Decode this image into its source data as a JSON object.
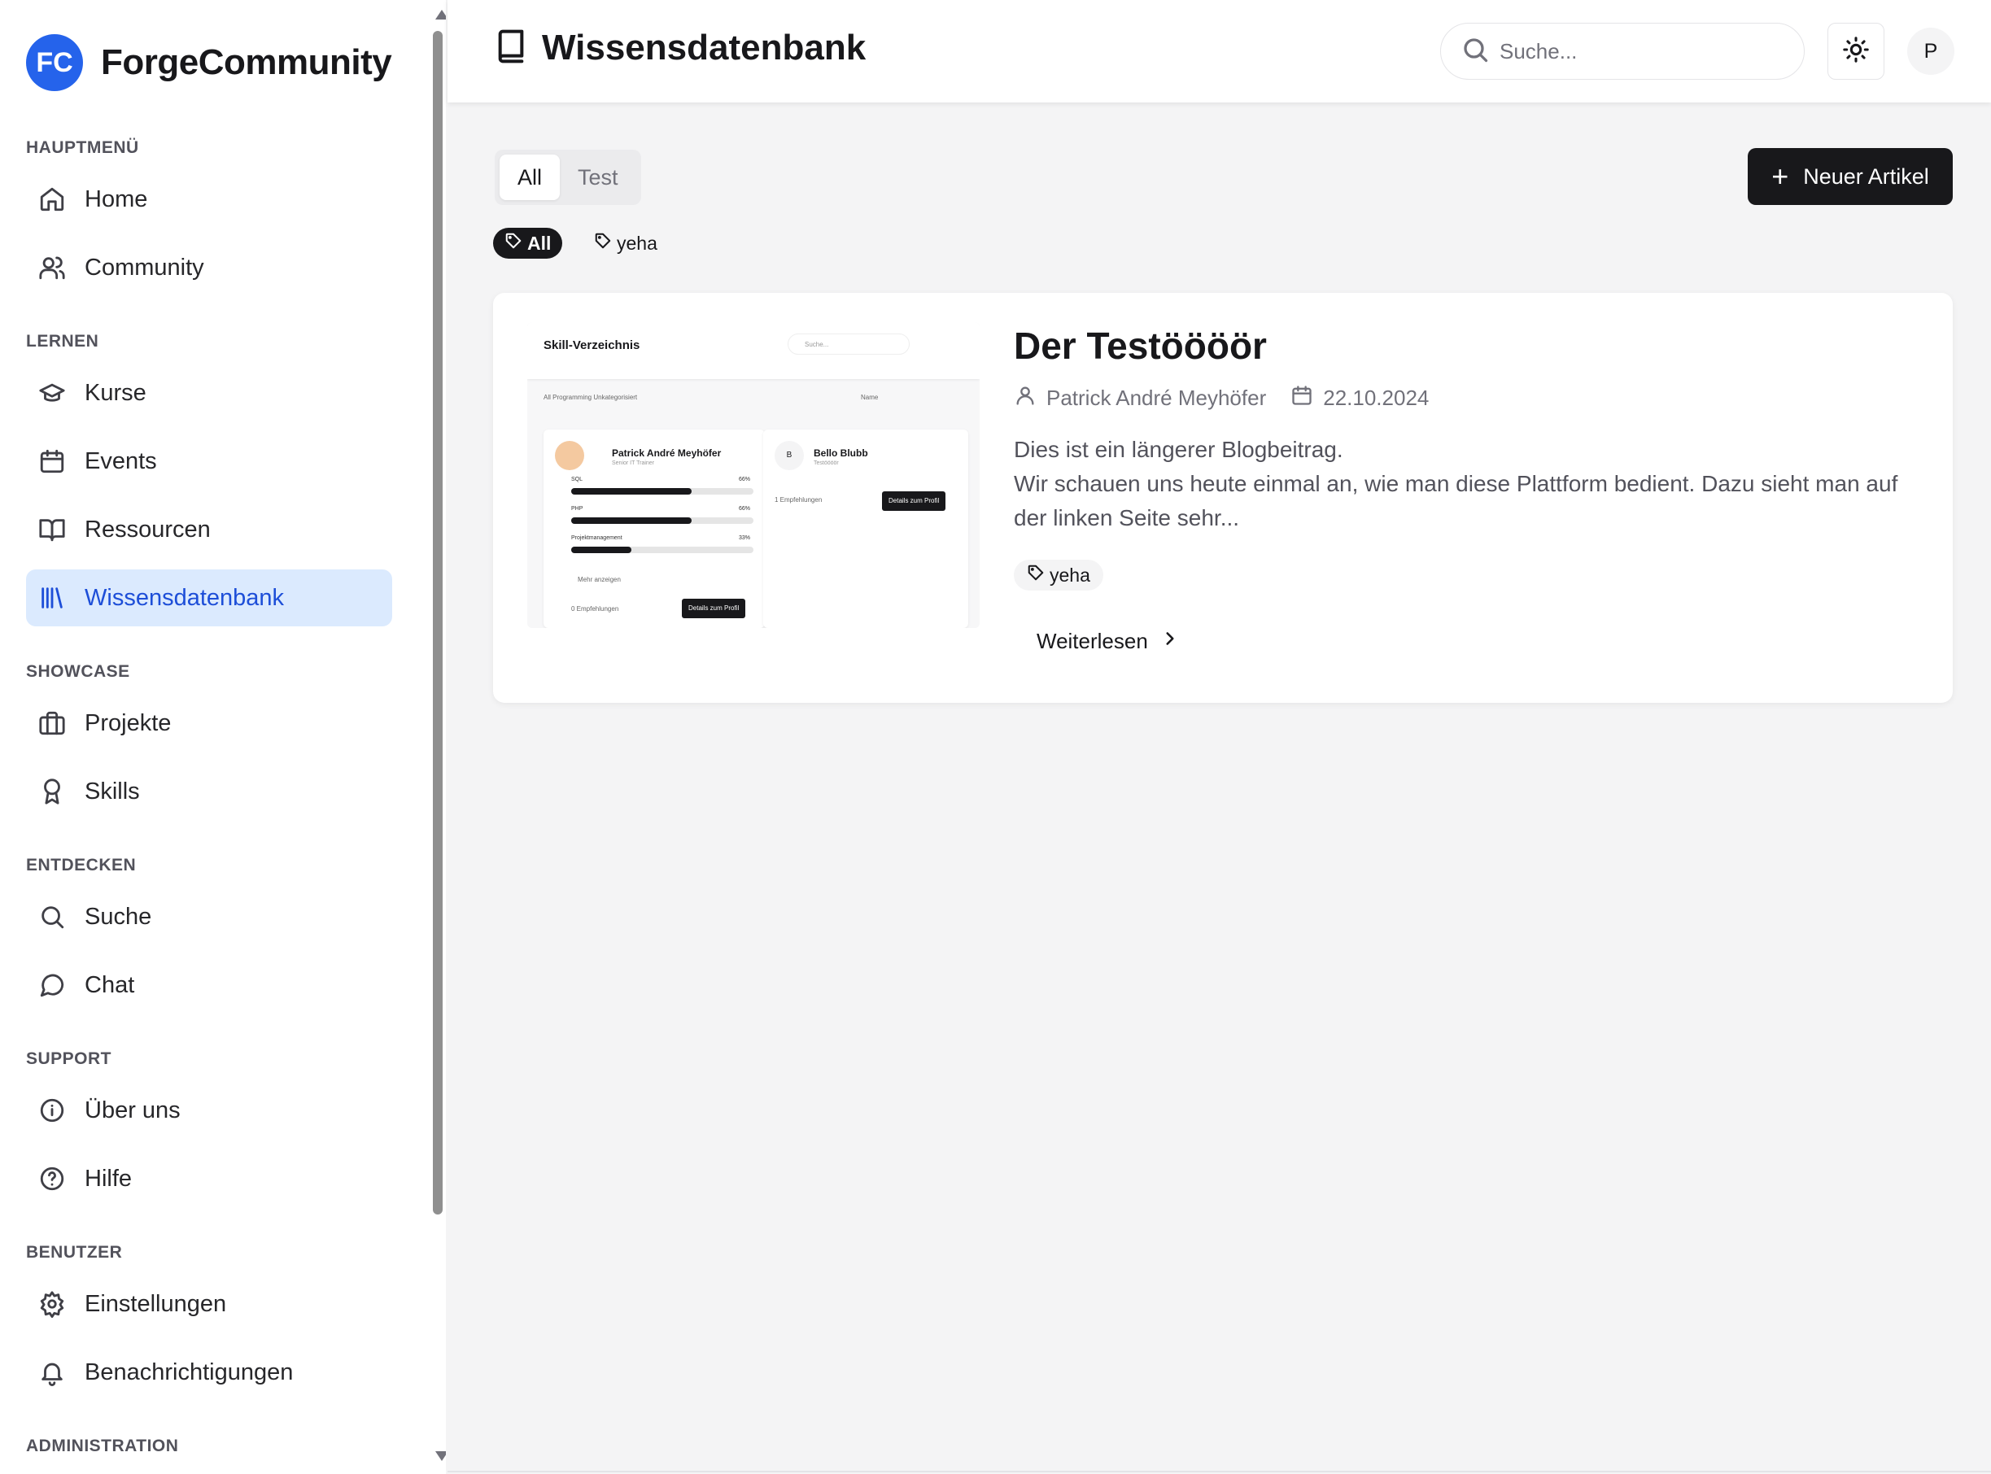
{
  "brand": {
    "logo_text": "FC",
    "name": "ForgeCommunity"
  },
  "sidebar": {
    "sections": [
      {
        "title": "HAUPTMENÜ",
        "items": [
          {
            "label": "Home",
            "icon": "home-icon"
          },
          {
            "label": "Community",
            "icon": "users-icon"
          }
        ]
      },
      {
        "title": "LERNEN",
        "items": [
          {
            "label": "Kurse",
            "icon": "graduation-cap-icon"
          },
          {
            "label": "Events",
            "icon": "calendar-icon"
          },
          {
            "label": "Ressourcen",
            "icon": "book-open-icon"
          },
          {
            "label": "Wissensdatenbank",
            "icon": "library-icon",
            "active": true
          }
        ]
      },
      {
        "title": "SHOWCASE",
        "items": [
          {
            "label": "Projekte",
            "icon": "briefcase-icon"
          },
          {
            "label": "Skills",
            "icon": "award-icon"
          }
        ]
      },
      {
        "title": "ENTDECKEN",
        "items": [
          {
            "label": "Suche",
            "icon": "search-icon"
          },
          {
            "label": "Chat",
            "icon": "chat-bubble-icon"
          }
        ]
      },
      {
        "title": "SUPPORT",
        "items": [
          {
            "label": "Über uns",
            "icon": "info-icon"
          },
          {
            "label": "Hilfe",
            "icon": "help-circle-icon"
          }
        ]
      },
      {
        "title": "BENUTZER",
        "items": [
          {
            "label": "Einstellungen",
            "icon": "gear-icon"
          },
          {
            "label": "Benachrichtigungen",
            "icon": "bell-icon"
          }
        ]
      },
      {
        "title": "ADMINISTRATION",
        "items": []
      }
    ]
  },
  "header": {
    "title": "Wissensdatenbank",
    "search_placeholder": "Suche...",
    "avatar_initial": "P"
  },
  "main": {
    "tabs": [
      {
        "label": "All",
        "active": true
      },
      {
        "label": "Test",
        "active": false
      }
    ],
    "new_button_label": "Neuer Artikel",
    "tag_filters": [
      {
        "label": "All",
        "active": true
      },
      {
        "label": "yeha",
        "active": false
      }
    ]
  },
  "article": {
    "title": "Der Testöööör",
    "author": "Patrick André Meyhöfer",
    "date": "22.10.2024",
    "excerpt_line1": "Dies ist ein längerer Blogbeitrag.",
    "excerpt_line2": "Wir schauen uns heute einmal an, wie man diese Plattform bedient. Dazu sieht man auf der linken Seite sehr...",
    "tag": "yeha",
    "read_more": "Weiterlesen",
    "thumbnail": {
      "title": "Skill-Verzeichnis",
      "search_placeholder": "Suche...",
      "tabs": "All   Programming   Unkategorisiert",
      "sort_label": "Name",
      "card1": {
        "name": "Patrick André Meyhöfer",
        "role": "Senior IT Trainer",
        "skills": [
          {
            "name": "SQL",
            "pct": "66%",
            "value": 0.66
          },
          {
            "name": "PHP",
            "pct": "66%",
            "value": 0.66
          },
          {
            "name": "Projektmanagement",
            "pct": "33%",
            "value": 0.33
          }
        ],
        "more": "Mehr anzeigen",
        "recommendations": "0 Empfehlungen",
        "button": "Details zum Profil"
      },
      "card2": {
        "name": "Bello Blubb",
        "role": "Testöööör",
        "initial": "B",
        "recommendations": "1 Empfehlungen",
        "button": "Details zum Profil"
      }
    }
  },
  "colors": {
    "accent": "#2563eb",
    "active_bg": "#dbeafe",
    "primary_button": "#18181b"
  }
}
